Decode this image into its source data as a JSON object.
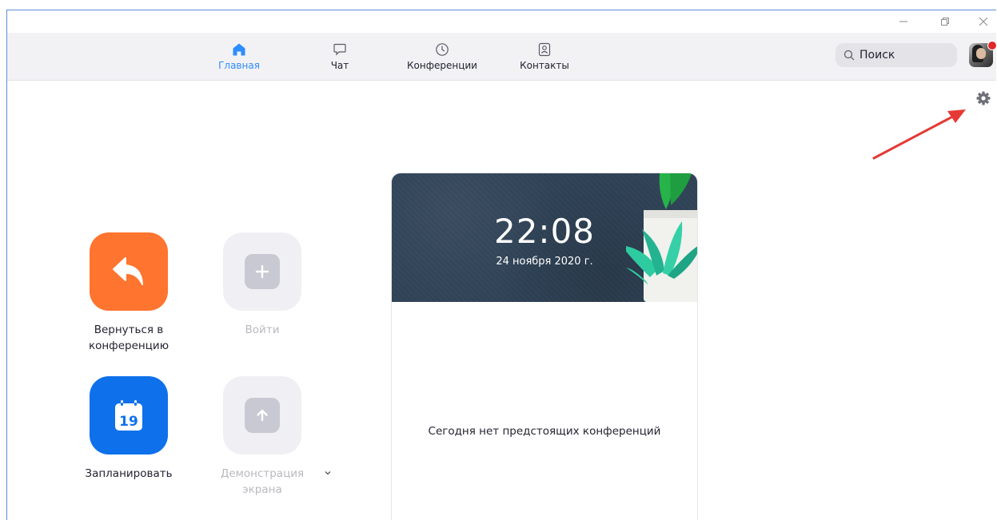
{
  "window": {
    "controls": {
      "minimize": "minimize-icon",
      "maximize": "restore-icon",
      "close": "close-icon"
    }
  },
  "nav": {
    "tabs": [
      {
        "label": "Главная",
        "icon": "home-icon",
        "active": true
      },
      {
        "label": "Чат",
        "icon": "chat-icon",
        "active": false
      },
      {
        "label": "Конференции",
        "icon": "clock-icon",
        "active": false
      },
      {
        "label": "Контакты",
        "icon": "contacts-icon",
        "active": false
      }
    ],
    "search": {
      "text": "Поиск",
      "icon": "search-icon"
    },
    "avatar": {
      "notification": true
    }
  },
  "actions": [
    {
      "label": "Вернуться в конференцию",
      "icon": "rejoin-arrow-icon",
      "color": "#ff742e",
      "enabled": true
    },
    {
      "label": "Войти",
      "icon": "plus-icon",
      "enabled": false
    },
    {
      "label": "Запланировать",
      "icon": "calendar-icon",
      "calendar_day": "19",
      "color": "#0e71eb",
      "enabled": true
    },
    {
      "label": "Демонстрация экрана",
      "icon": "share-screen-icon",
      "enabled": false
    }
  ],
  "calendar_card": {
    "time": "22:08",
    "date": "24 ноября 2020 г.",
    "empty_message": "Сегодня нет предстоящих конференций"
  },
  "colors": {
    "accent": "#2d8cff",
    "annotation_arrow": "#e53935"
  }
}
